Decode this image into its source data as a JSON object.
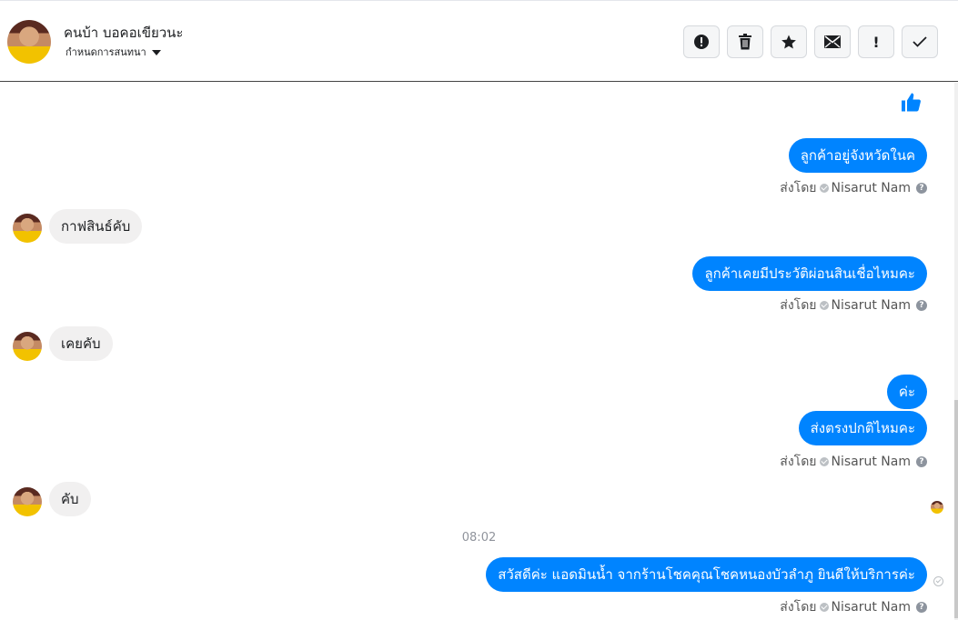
{
  "header": {
    "name": "คนบ้า บอคอเขียวนะ",
    "subtitle": "กำหนดการสนทนา",
    "tools": [
      {
        "icon": "alert-circle-icon"
      },
      {
        "icon": "trash-icon"
      },
      {
        "icon": "star-icon"
      },
      {
        "icon": "mail-icon"
      },
      {
        "icon": "exclamation-icon",
        "label": "!"
      },
      {
        "icon": "check-icon"
      }
    ]
  },
  "messages": [
    {
      "from": "page",
      "type": "like",
      "icon": "thumbs-up-icon"
    },
    {
      "from": "page",
      "text": "ลูกค้าอยู่จังหวัดในค"
    },
    {
      "from": "page",
      "type": "sent_by",
      "prefix": "ส่งโดย",
      "agent": "Nisarut Nam"
    },
    {
      "from": "customer",
      "text": "กาฟสินธ์คับ"
    },
    {
      "from": "page",
      "text": "ลูกค้าเคยมีประวัติผ่อนสินเชื่อไหมคะ"
    },
    {
      "from": "page",
      "type": "sent_by",
      "prefix": "ส่งโดย",
      "agent": "Nisarut Nam"
    },
    {
      "from": "customer",
      "text": "เคยคับ"
    },
    {
      "from": "page",
      "text": "ค่ะ"
    },
    {
      "from": "page",
      "text": "ส่งตรงปกติไหมคะ"
    },
    {
      "from": "page",
      "type": "sent_by",
      "prefix": "ส่งโดย",
      "agent": "Nisarut Nam"
    },
    {
      "from": "customer",
      "text": "คับ"
    },
    {
      "type": "timestamp",
      "text": "08:02"
    },
    {
      "from": "page",
      "text": "สวัสดีค่ะ แอดมินน้ำ จากร้านโชคคุณโชคหนองบัวลำภู ยินดีให้บริการค่ะ"
    },
    {
      "from": "page",
      "type": "sent_by",
      "prefix": "ส่งโดย",
      "agent": "Nisarut Nam"
    }
  ],
  "colors": {
    "outgoing": "#0084ff",
    "incoming": "#f1f0f0",
    "accent": "#0084ff"
  }
}
